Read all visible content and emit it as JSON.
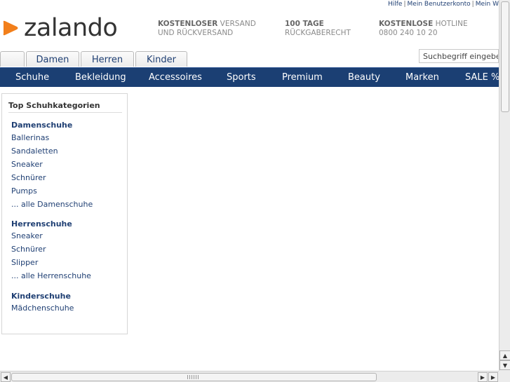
{
  "utility_links": [
    "Hilfe",
    "Mein Benutzerkonto",
    "Mein Wun"
  ],
  "logo": {
    "text": "zalando",
    "mark_color": "#f27f1b",
    "icon": "zalando-logo-mark"
  },
  "usps": [
    {
      "bold": "KOSTENLOSER",
      "rest": " VERSAND",
      "line2": "UND RÜCKVERSAND"
    },
    {
      "bold": "100 TAGE",
      "rest": "",
      "line2": "RÜCKGABERECHT"
    },
    {
      "bold": "KOSTENLOSE",
      "rest": " HOTLINE",
      "line2": "0800 240 10 20"
    }
  ],
  "gender_tabs": [
    "",
    "Damen",
    "Herren",
    "Kinder"
  ],
  "search": {
    "placeholder": "Suchbegriff eingeben..."
  },
  "nav": {
    "items": [
      "Schuhe",
      "Bekleidung",
      "Accessoires",
      "Sports",
      "Premium",
      "Beauty",
      "Marken",
      "SALE %"
    ],
    "bg_color": "#1b3f73"
  },
  "sidebar": {
    "title": "Top Schuhkategorien",
    "groups": [
      {
        "heading": "Damenschuhe",
        "links": [
          "Ballerinas",
          "Sandaletten",
          "Sneaker",
          "Schnürer",
          "Pumps",
          "... alle Damenschuhe"
        ]
      },
      {
        "heading": "Herrenschuhe",
        "links": [
          "Sneaker",
          "Schnürer",
          "Slipper",
          "... alle Herrenschuhe"
        ]
      },
      {
        "heading": "Kinderschuhe",
        "links": [
          "Mädchenschuhe"
        ]
      }
    ]
  },
  "colors": {
    "link": "#1f3f73",
    "accent": "#f27f1b"
  }
}
